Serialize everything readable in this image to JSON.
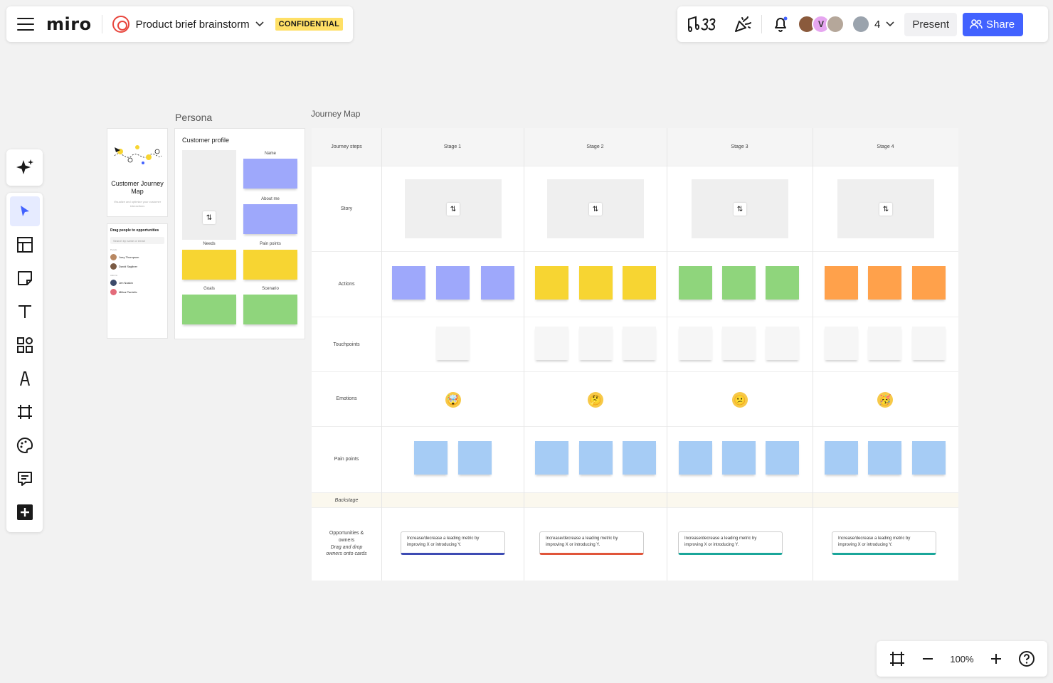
{
  "topbar": {
    "logo": "miro",
    "board_title": "Product brief brainstorm",
    "badge": "CONFIDENTIAL",
    "collaborator_count": "4",
    "avatar_initial": "V",
    "present_label": "Present",
    "share_label": "Share"
  },
  "zoom": {
    "level": "100%"
  },
  "frames": {
    "persona": "Persona",
    "journey": "Journey Map"
  },
  "intro_card": {
    "title": "Customer Journey Map",
    "subtitle": "Visualize and optimize your customer interactions"
  },
  "people_card": {
    "heading": "Drag people to opportunities",
    "search_placeholder": "Search by name or email",
    "group1": "People",
    "group2": "Admins",
    "people": [
      "Joey Thompson",
      "David Sagliner",
      "Jen Nuskin",
      "Milica Pantelic"
    ]
  },
  "persona": {
    "title": "Customer profile",
    "labels": {
      "name": "Name",
      "about": "About me",
      "needs": "Needs",
      "pain": "Pain points",
      "goals": "Goals",
      "scenario": "Scenario"
    }
  },
  "journey": {
    "row_labels": {
      "steps": "Journey steps",
      "story": "Story",
      "actions": "Actions",
      "touchpoints": "Touchpoints",
      "emotions": "Emotions",
      "pain": "Pain points",
      "backstage": "Backstage",
      "opp_line1": "Opportunities &",
      "opp_line2": "owners",
      "opp_line3": "Drag and drop",
      "opp_line4": "owners onto cards"
    },
    "stages": [
      "Stage 1",
      "Stage 2",
      "Stage 3",
      "Stage 4"
    ],
    "emotions": [
      "🤯",
      "🤔",
      "😕",
      "🥳"
    ],
    "opportunity_text": "Increase/decrease a leading metric by improving X or introducing Y.",
    "colors": {
      "purple": "#9ea8fb",
      "yellow": "#f7d532",
      "green": "#8fd57c",
      "orange": "#ffa14b",
      "blue": "#a6ccf5",
      "white": "#f6f6f6"
    },
    "opp_borders": [
      "#3d4bb3",
      "#e0553a",
      "#1aa69a",
      "#1aa69a"
    ]
  }
}
